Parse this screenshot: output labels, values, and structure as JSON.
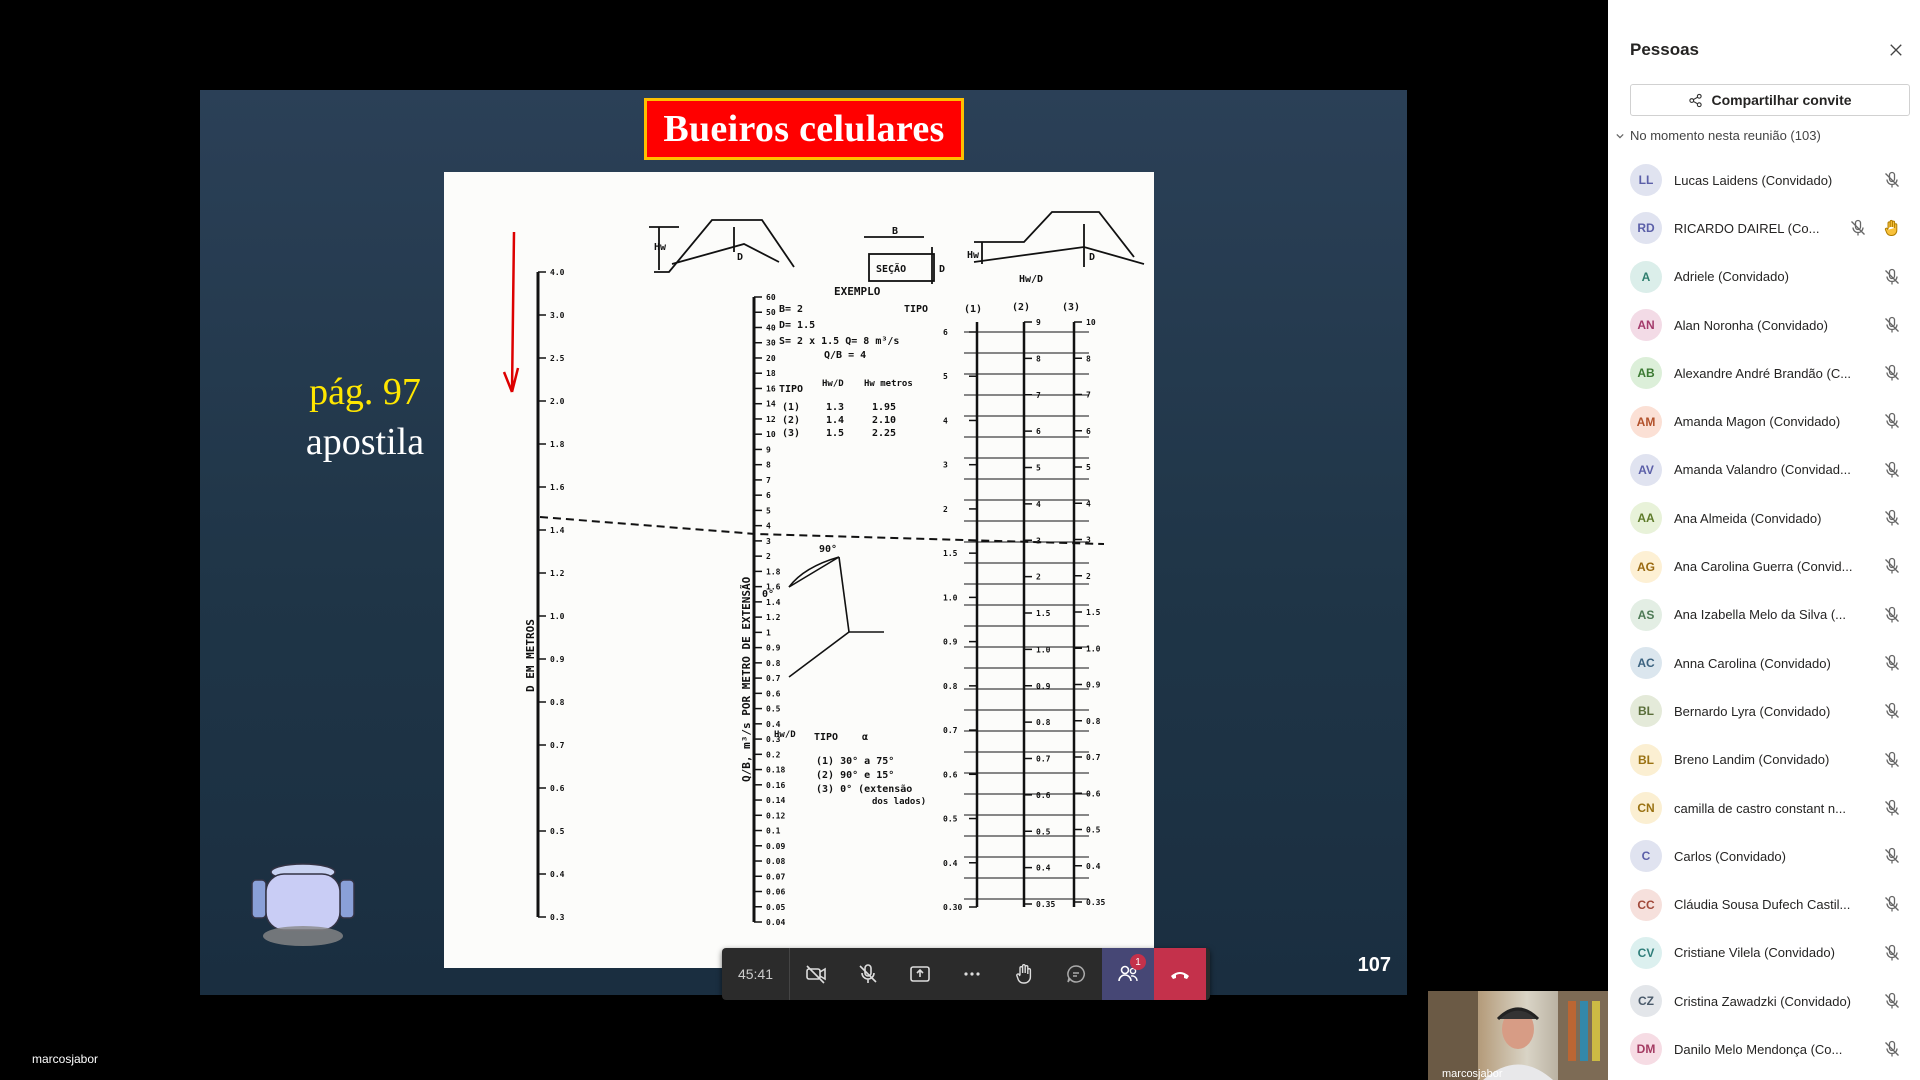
{
  "slide": {
    "title": "Bueiros celulares",
    "page_ref": "pág. 97",
    "page_ref_sub": "apostila",
    "slide_number": "107"
  },
  "scan": {
    "left_axis_label": "D EM METROS",
    "left_ticks": [
      "4.0",
      "3.0",
      "2.5",
      "2.0",
      "1.8",
      "1.6",
      "1.4",
      "1.2",
      "1.0",
      "0.9",
      "0.8",
      "0.7",
      "0.6",
      "0.5",
      "0.4",
      "0.3"
    ],
    "mid_axis_label": "Q/B, m³/s POR METRO DE EXTENSÃO",
    "mid_ticks": [
      "60",
      "50",
      "40",
      "30",
      "20",
      "18",
      "16",
      "14",
      "12",
      "10",
      "9",
      "8",
      "7",
      "6",
      "5",
      "4",
      "3",
      "2",
      "1.8",
      "1.6",
      "1.4",
      "1.2",
      "1",
      "0.9",
      "0.8",
      "0.7",
      "0.6",
      "0.5",
      "0.4",
      "0.3",
      "0.2",
      "0.18",
      "0.16",
      "0.14",
      "0.12",
      "0.1",
      "0.09",
      "0.08",
      "0.07",
      "0.06",
      "0.05",
      "0.04"
    ],
    "exemplo": {
      "title": "EXEMPLO",
      "lines": [
        "B= 2",
        "D= 1.5",
        "S= 2 x 1.5   Q= 8 m³/s",
        "Q/B = 4"
      ],
      "table_header": [
        "TIPO",
        "Hw/D",
        "Hw metros"
      ],
      "rows": [
        [
          "(1)",
          "1.3",
          "1.95"
        ],
        [
          "(2)",
          "1.4",
          "2.10"
        ],
        [
          "(3)",
          "1.5",
          "2.25"
        ]
      ]
    },
    "tipo_header": "TIPO",
    "tipo_cols": [
      "(1)",
      "(2)",
      "(3)"
    ],
    "hw_d_label": "Hw/D",
    "section_labels": {
      "b": "B",
      "secao": "SEÇÃO",
      "d": "D",
      "hw": "Hw"
    },
    "angle_labels": {
      "top": "90°",
      "left": "0°"
    },
    "legend_header": [
      "Hw/D",
      "TIPO",
      "α"
    ],
    "legend_rows": [
      "(1)   30° a 75°",
      "(2)   90° e 15°",
      "(3)   0°  (extensão",
      "dos lados)"
    ],
    "scale1_ticks": [
      "6",
      "5",
      "4",
      "3",
      "2",
      "1.5",
      "1.0",
      "0.9",
      "0.8",
      "0.7",
      "0.6",
      "0.5",
      "0.4",
      "0.30"
    ],
    "scale2_ticks": [
      "9",
      "8",
      "7",
      "6",
      "5",
      "4",
      "3",
      "2",
      "1.5",
      "1.0",
      "0.9",
      "0.8",
      "0.7",
      "0.6",
      "0.5",
      "0.4",
      "0.35"
    ],
    "scale3_ticks": [
      "10",
      "8",
      "7",
      "6",
      "5",
      "4",
      "3",
      "2",
      "1.5",
      "1.0",
      "0.9",
      "0.8",
      "0.7",
      "0.6",
      "0.5",
      "0.4",
      "0.35"
    ]
  },
  "call": {
    "timer": "45:41",
    "participants_badge": "1",
    "presenter_name": "marcosjabor",
    "self_video_name": "marcosjabor"
  },
  "people": {
    "title": "Pessoas",
    "share_invite": "Compartilhar convite",
    "in_meeting": "No momento nesta reunião (103)",
    "participants": [
      {
        "initials": "LL",
        "name": "Lucas Laidens (Convidado)",
        "bg": "#e0e3f0",
        "fg": "#5b5fa8"
      },
      {
        "initials": "RD",
        "name": "RICARDO DAIREL (Co...",
        "bg": "#e0e3f0",
        "fg": "#5b5fa8",
        "hand": true
      },
      {
        "initials": "A",
        "name": "Adriele (Convidado)",
        "bg": "#dbeeea",
        "fg": "#2f7e6e"
      },
      {
        "initials": "AN",
        "name": "Alan Noronha (Convidado)",
        "bg": "#f3dbe6",
        "fg": "#a43b6b"
      },
      {
        "initials": "AB",
        "name": "Alexandre André Brandão (C...",
        "bg": "#dcefd9",
        "fg": "#3c7a33"
      },
      {
        "initials": "AM",
        "name": "Amanda Magon (Convidado)",
        "bg": "#fbe0d5",
        "fg": "#b2512b"
      },
      {
        "initials": "AV",
        "name": "Amanda Valandro (Convidad...",
        "bg": "#e0e3f0",
        "fg": "#5b5fa8"
      },
      {
        "initials": "AA",
        "name": "Ana Almeida (Convidado)",
        "bg": "#e8f2d9",
        "fg": "#5e7b2a"
      },
      {
        "initials": "AG",
        "name": "Ana Carolina Guerra (Convid...",
        "bg": "#fdf0d4",
        "fg": "#9a6a12"
      },
      {
        "initials": "AS",
        "name": "Ana Izabella Melo da Silva (...",
        "bg": "#e3eee4",
        "fg": "#4d7a55"
      },
      {
        "initials": "AC",
        "name": "Anna Carolina (Convidado)",
        "bg": "#dbe6ee",
        "fg": "#3c6380"
      },
      {
        "initials": "BL",
        "name": "Bernardo Lyra (Convidado)",
        "bg": "#e4ead9",
        "fg": "#5a6e3a"
      },
      {
        "initials": "BL",
        "name": "Breno Landim (Convidado)",
        "bg": "#fbefd2",
        "fg": "#9a7212"
      },
      {
        "initials": "CN",
        "name": "camilla de castro constant n...",
        "bg": "#fbefd2",
        "fg": "#9a7212"
      },
      {
        "initials": "C",
        "name": "Carlos (Convidado)",
        "bg": "#e0e3f0",
        "fg": "#5b5fa8"
      },
      {
        "initials": "CC",
        "name": "Cláudia Sousa Dufech Castil...",
        "bg": "#f6e0dc",
        "fg": "#a1493a"
      },
      {
        "initials": "CV",
        "name": "Cristiane Vilela (Convidado)",
        "bg": "#dcf0ef",
        "fg": "#2f7e7a"
      },
      {
        "initials": "CZ",
        "name": "Cristina Zawadzki (Convidado)",
        "bg": "#e3e6ea",
        "fg": "#4a5a6a"
      },
      {
        "initials": "DM",
        "name": "Danilo Melo Mendonça (Co...",
        "bg": "#f6dce4",
        "fg": "#a43b62"
      }
    ]
  }
}
